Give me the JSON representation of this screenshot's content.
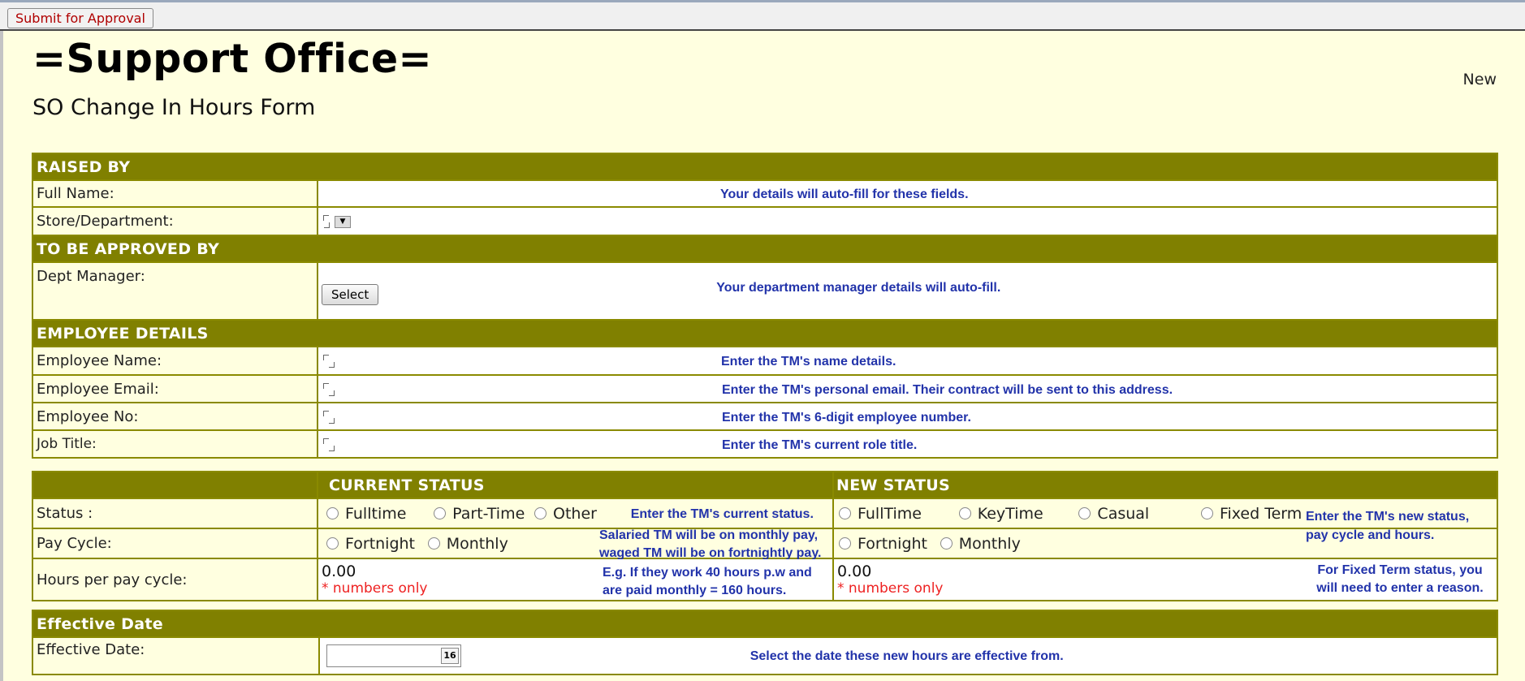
{
  "toolbar": {
    "submit_label": "Submit for Approval"
  },
  "header": {
    "title": "=Support Office=",
    "subtitle": "SO Change In Hours Form",
    "status": "New"
  },
  "raised_by": {
    "section": "RAISED BY",
    "full_name_label": "Full Name:",
    "autofill_hint": "Your details will auto-fill for these fields.",
    "store_label": "Store/Department:"
  },
  "approval": {
    "section": "TO BE APPROVED BY",
    "manager_label": "Dept Manager:",
    "select_label": "Select",
    "hint": "Your department manager details will auto-fill."
  },
  "employee": {
    "section": "EMPLOYEE DETAILS",
    "name_label": "Employee Name:",
    "name_hint": "Enter the TM's name details.",
    "email_label": "Employee Email:",
    "email_hint": "Enter the TM's personal email. Their contract will be sent to this address.",
    "no_label": "Employee No:",
    "no_hint": "Enter the TM's 6-digit employee number.",
    "job_label": "Job Title:",
    "job_hint": "Enter the TM's current role title."
  },
  "status_section": {
    "current_header": "CURRENT STATUS",
    "new_header": "NEW STATUS",
    "status_label": "Status :",
    "current_options": [
      "Fulltime",
      "Part-Time",
      "Other"
    ],
    "current_hint": "Enter the TM's current status.",
    "new_options": [
      "FullTime",
      "KeyTime",
      "Casual",
      "Fixed Term"
    ],
    "new_hint": "Enter the TM's new status, pay cycle and hours.",
    "pay_label": "Pay Cycle:",
    "pay_options": [
      "Fortnight",
      "Monthly"
    ],
    "pay_hint": "Salaried TM will be on monthly pay, waged TM will be on fortnightly pay.",
    "new_pay_options": [
      "Fortnight",
      "Monthly"
    ],
    "hours_label": "Hours per pay cycle:",
    "current_hours": "0.00",
    "new_hours": "0.00",
    "numbers_only": "* numbers only",
    "hours_hint": "E.g. If they work 40 hours p.w and are paid monthly = 160 hours.",
    "fixed_hint": "For Fixed Term status, you will need to enter a reason."
  },
  "effective": {
    "section": "Effective Date",
    "label": "Effective Date:",
    "calendar": "16",
    "hint": "Select the date these new hours are effective from."
  },
  "colors": {
    "section_bg": "#808000",
    "page_bg": "#ffffe0",
    "hint": "#2233aa",
    "required": "#ee2222"
  }
}
